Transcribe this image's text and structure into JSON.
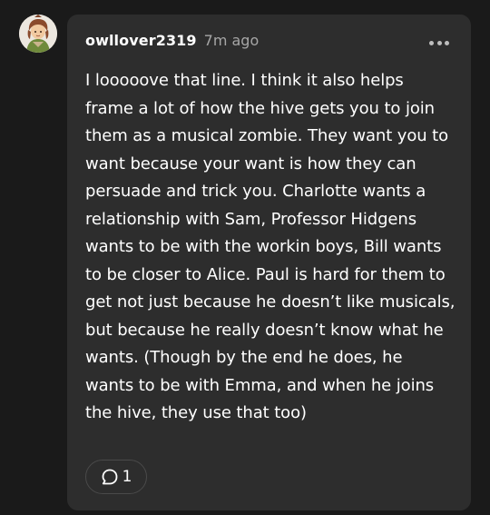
{
  "comment": {
    "username": "owllover2319",
    "timestamp": "7m ago",
    "avatar_icon": "avatar-icon",
    "more_icon": "more-options-icon",
    "body": "I looooove that line. I think it also helps frame a lot of how the hive gets you to join them as a musical zombie. They want you to want because your want is how they can persuade and trick you. Charlotte wants a relationship with Sam, Professor Hidgens wants to be with the workin boys, Bill wants to be closer to Alice. Paul is hard for them to get not just because he doesn’t like musicals, but because he really doesn’t know what he wants. (Though by the end he does, he wants to be with Emma, and when he joins the hive, they use that too)",
    "reply_icon": "reply-bubble-icon",
    "reply_count": "1"
  },
  "colors": {
    "background": "#1a1a1a",
    "card": "#2d2d2d",
    "text": "#ffffff",
    "muted": "#a6a6a6",
    "border": "#4a4a4a"
  }
}
